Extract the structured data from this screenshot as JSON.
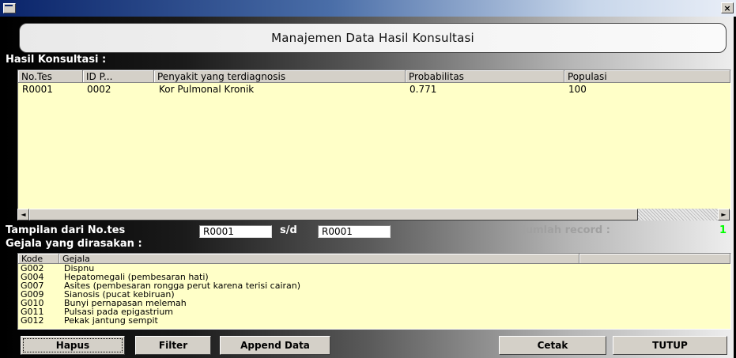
{
  "window": {
    "close_glyph": "×"
  },
  "banner": {
    "title": "Manajemen Data Hasil Konsultasi"
  },
  "hasil": {
    "label": "Hasil Konsultasi :",
    "columns": [
      "No.Tes",
      "ID P...",
      "Penyakit yang terdiagnosis",
      "Probabilitas",
      "Populasi"
    ],
    "rows": [
      [
        "R0001",
        "0002",
        "Kor Pulmonal Kronik",
        "0.771",
        "100"
      ]
    ]
  },
  "scrollbar": {
    "left_glyph": "◄",
    "right_glyph": "►"
  },
  "filter": {
    "label": "Tampilan dari No.tes",
    "from_value": "R0001",
    "sd_label": "s/d",
    "to_value": "R0001"
  },
  "record": {
    "label": "Jumlah record  :",
    "value": "1"
  },
  "gejala": {
    "label": "Gejala yang dirasakan  :",
    "columns": [
      "Kode",
      "Gejala"
    ],
    "rows": [
      [
        "G002",
        "Dispnu"
      ],
      [
        "G004",
        "Hepatomegali (pembesaran hati)"
      ],
      [
        "G007",
        "Asites (pembesaran rongga perut karena terisi cairan)"
      ],
      [
        "G009",
        "Sianosis (pucat kebiruan)"
      ],
      [
        "G010",
        "Bunyi pernapasan melemah"
      ],
      [
        "G011",
        "Pulsasi pada epigastrium"
      ],
      [
        "G012",
        "Pekak jantung sempit"
      ]
    ]
  },
  "buttons": {
    "hapus": "Hapus",
    "filter": "Filter",
    "append": "Append Data",
    "cetak": "Cetak",
    "tutup": "TUTUP"
  },
  "colors": {
    "list_bg": "#ffffc8",
    "record_value": "#00ff00",
    "record_label": "#a0a0a0"
  },
  "icons": [
    "app-window-icon",
    "close-icon",
    "scroll-left-arrow-icon",
    "scroll-right-arrow-icon"
  ]
}
